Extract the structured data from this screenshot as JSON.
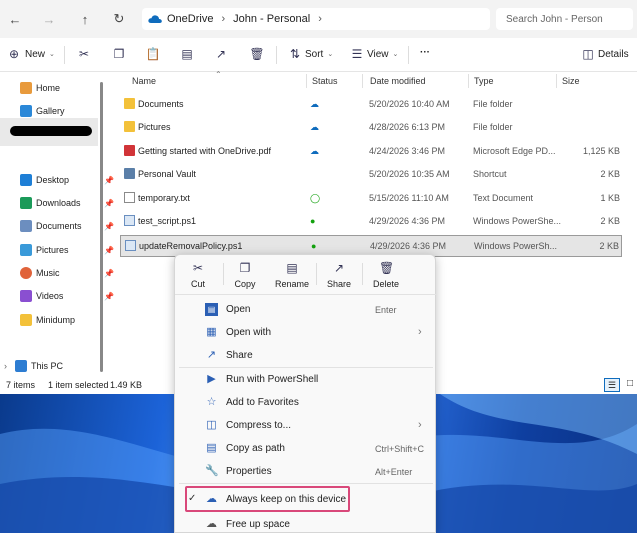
{
  "address": {
    "segments": [
      "OneDrive",
      "John - Personal"
    ],
    "search_placeholder": "Search John - Person"
  },
  "toolbar": {
    "new_label": "New",
    "sort_label": "Sort",
    "view_label": "View",
    "more_label": "···",
    "details_label": "Details"
  },
  "sidebar": {
    "home": "Home",
    "gallery": "Gallery",
    "desktop": "Desktop",
    "downloads": "Downloads",
    "documents": "Documents",
    "pictures": "Pictures",
    "music": "Music",
    "videos": "Videos",
    "minidump": "Minidump",
    "thispc": "This PC"
  },
  "columns": {
    "name": "Name",
    "status": "Status",
    "date": "Date modified",
    "type": "Type",
    "size": "Size"
  },
  "files": [
    {
      "name": "Documents",
      "status": "cloud",
      "date": "5/20/2026 10:40 AM",
      "type": "File folder",
      "size": "",
      "icon": "folder-icon"
    },
    {
      "name": "Pictures",
      "status": "cloud",
      "date": "4/28/2026 6:13 PM",
      "type": "File folder",
      "size": "",
      "icon": "folder-icon"
    },
    {
      "name": "Getting started with OneDrive.pdf",
      "status": "cloud",
      "date": "4/24/2026 3:46 PM",
      "type": "Microsoft Edge PD...",
      "size": "1,125 KB",
      "icon": "pdf-icon"
    },
    {
      "name": "Personal Vault",
      "status": "",
      "date": "5/20/2026 10:35 AM",
      "type": "Shortcut",
      "size": "2 KB",
      "icon": "vault-icon"
    },
    {
      "name": "temporary.txt",
      "status": "available",
      "date": "5/15/2026 11:10 AM",
      "type": "Text Document",
      "size": "1 KB",
      "icon": "txt-icon"
    },
    {
      "name": "test_script.ps1",
      "status": "always",
      "date": "4/29/2026 4:36 PM",
      "type": "Windows PowerShe...",
      "size": "2 KB",
      "icon": "ps1-icon"
    },
    {
      "name": "updateRemovalPolicy.ps1",
      "status": "always",
      "date": "4/29/2026 4:36 PM",
      "type": "Windows PowerSh...",
      "size": "2 KB",
      "icon": "ps1-icon"
    }
  ],
  "statusbar": {
    "count": "7 items",
    "selected": "1 item selected",
    "size": "1.49 KB"
  },
  "context_menu": {
    "quick_actions": [
      "Cut",
      "Copy",
      "Rename",
      "Share",
      "Delete"
    ],
    "items": [
      {
        "label": "Open",
        "shortcut": "Enter",
        "arrow": false
      },
      {
        "label": "Open with",
        "shortcut": "",
        "arrow": true
      },
      {
        "label": "Share",
        "shortcut": "",
        "arrow": false
      },
      {
        "label": "Run with PowerShell",
        "shortcut": "",
        "arrow": false
      },
      {
        "label": "Add to Favorites",
        "shortcut": "",
        "arrow": false
      },
      {
        "label": "Compress to...",
        "shortcut": "",
        "arrow": true
      },
      {
        "label": "Copy as path",
        "shortcut": "Ctrl+Shift+C",
        "arrow": false
      },
      {
        "label": "Properties",
        "shortcut": "Alt+Enter",
        "arrow": false
      },
      {
        "label": "Always keep on this device",
        "shortcut": "",
        "arrow": false
      },
      {
        "label": "Free up space",
        "shortcut": "",
        "arrow": false
      }
    ]
  },
  "colors": {
    "accent": "#0f6cbd",
    "folder": "#f3c13a",
    "synced_green": "#13a10e",
    "highlight": "#d9487a"
  }
}
